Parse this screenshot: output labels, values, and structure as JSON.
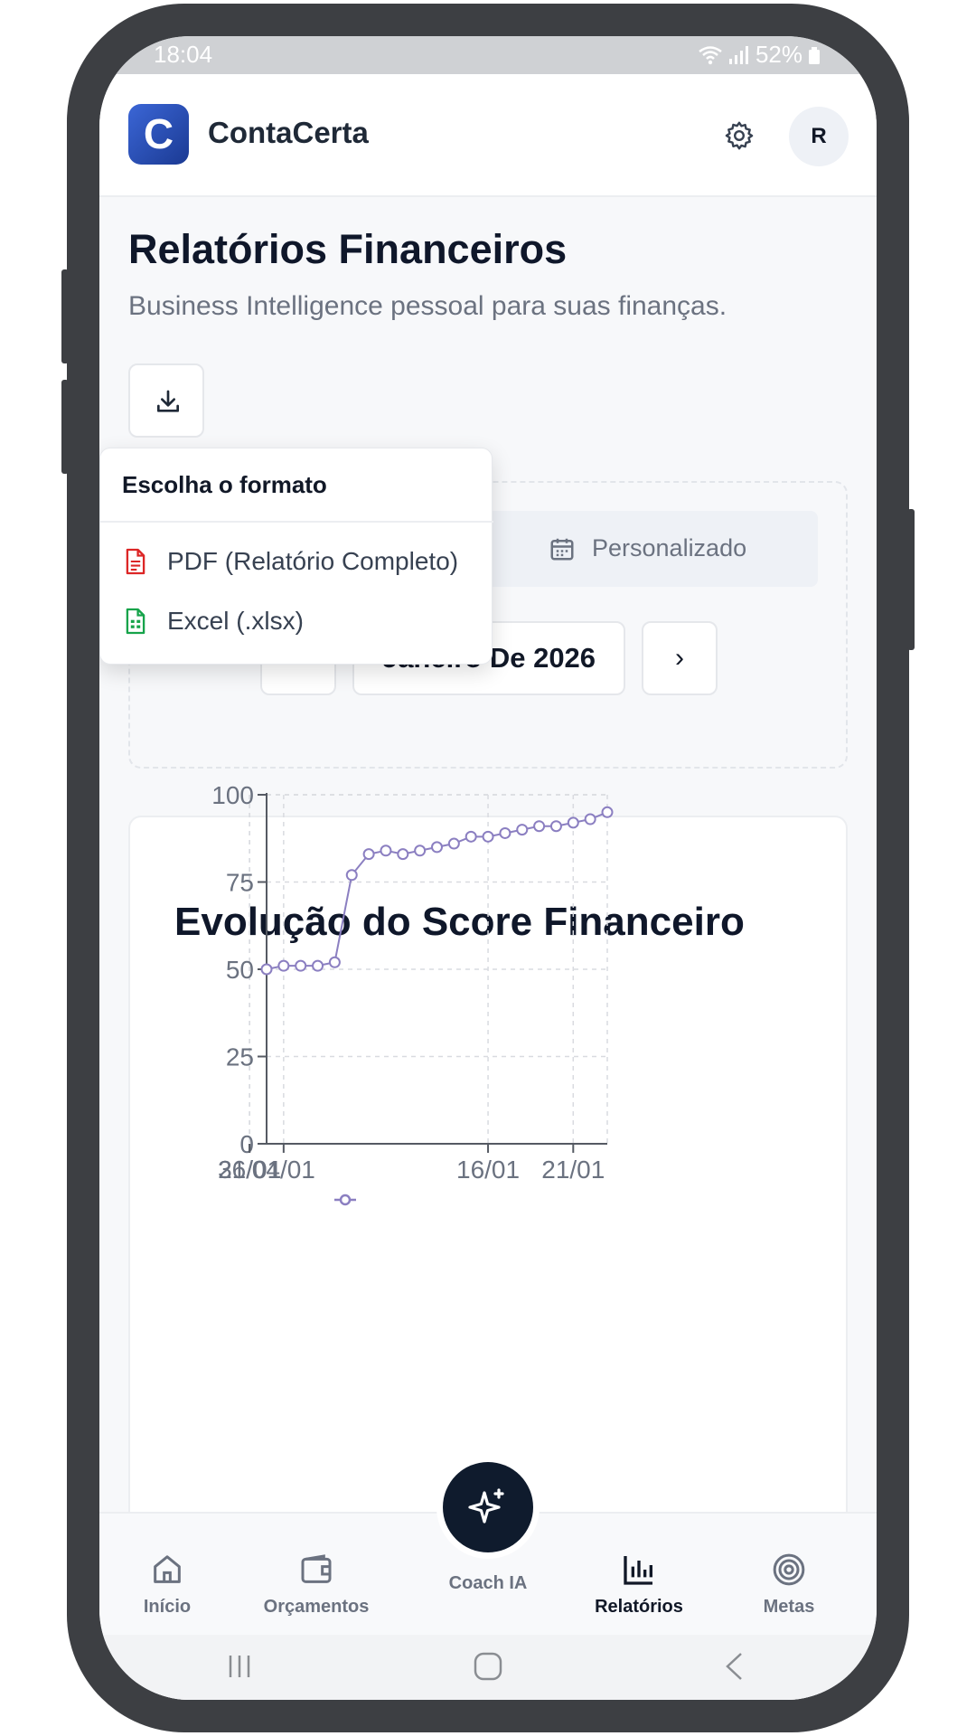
{
  "status_bar": {
    "time": "18:04",
    "battery": "52%"
  },
  "app": {
    "name": "ContaCerta",
    "logo_letter": "C",
    "avatar_initial": "R"
  },
  "page": {
    "title": "Relatórios Financeiros",
    "subtitle": "Business Intelligence pessoal para suas finanças."
  },
  "export_menu": {
    "header": "Escolha o formato",
    "options": [
      {
        "label": "PDF (Relatório Completo)",
        "icon": "pdf-file-icon",
        "color": "#dc2626"
      },
      {
        "label": "Excel (.xlsx)",
        "icon": "spreadsheet-file-icon",
        "color": "#16a34a"
      }
    ]
  },
  "period_filter": {
    "custom_label": "Personalizado",
    "month_label": "Janeiro De 2026",
    "prev_icon": "chevron-left-icon",
    "next_icon": "chevron-right-icon"
  },
  "score_chart": {
    "title": "Evolução do Score Financeiro",
    "line_color": "#8b7fc1"
  },
  "chart_data": {
    "type": "line",
    "title": "Evolução do Score Financeiro",
    "x": [
      "03/01",
      "04/01",
      "05/01",
      "06/01",
      "07/01",
      "08/01",
      "09/01",
      "10/01",
      "11/01",
      "12/01",
      "13/01",
      "14/01",
      "15/01",
      "16/01",
      "17/01",
      "18/01",
      "19/01",
      "20/01",
      "21/01",
      "22/01",
      "23/01"
    ],
    "series": [
      {
        "values": [
          50,
          51,
          51,
          51,
          52,
          77,
          83,
          84,
          83,
          84,
          85,
          86,
          88,
          88,
          89,
          90,
          91,
          91,
          92,
          93,
          95
        ]
      }
    ],
    "x_ticks": [
      "04/01",
      "16/01",
      "21/01",
      "26/01",
      "31/01"
    ],
    "y_ticks": [
      0,
      25,
      50,
      75,
      100
    ],
    "ylim": [
      0,
      100
    ],
    "grid": true
  },
  "bottom_nav": {
    "items": [
      {
        "label": "Início",
        "icon": "home-icon"
      },
      {
        "label": "Orçamentos",
        "icon": "wallet-icon"
      },
      {
        "label": "Relatórios",
        "icon": "bar-chart-icon",
        "active": true
      },
      {
        "label": "Metas",
        "icon": "target-icon"
      }
    ],
    "coach_label": "Coach IA"
  }
}
